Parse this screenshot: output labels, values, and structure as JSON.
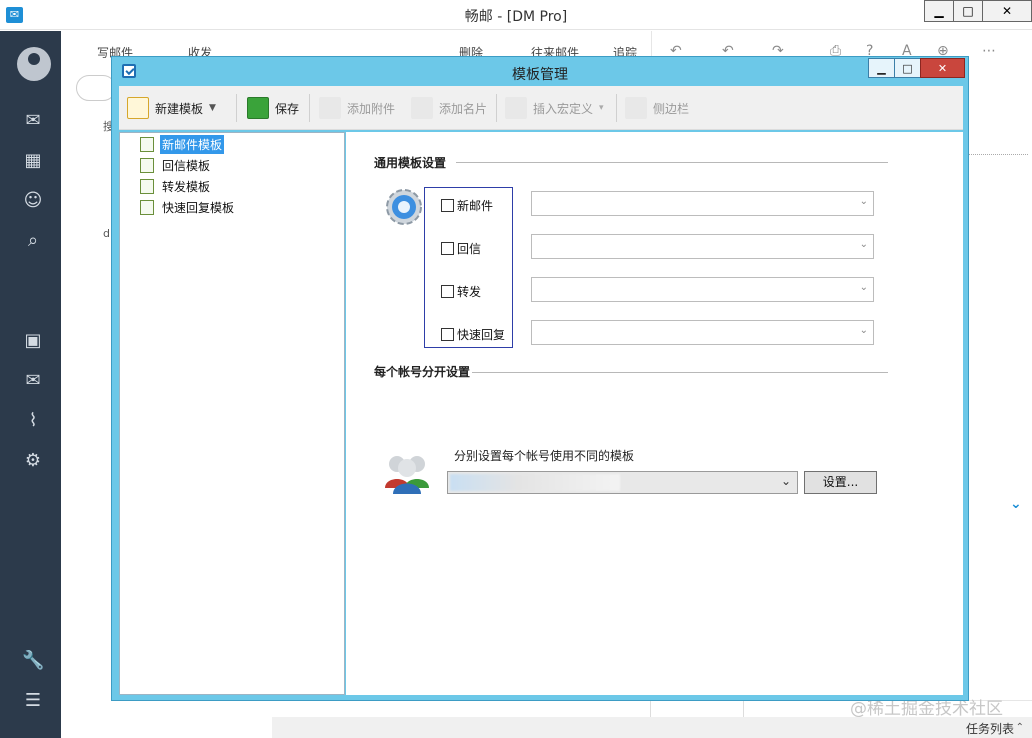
{
  "main_window": {
    "title": "畅邮 - [DM Pro]",
    "controls": {
      "minimize": "▁",
      "maximize": "□",
      "close": "✕"
    }
  },
  "background": {
    "toolbar": {
      "compose": "写邮件",
      "receive": "收发",
      "delete": "删除",
      "thread": "往来邮件",
      "track": "追踪"
    },
    "tree_labels": [
      "搜",
      "d"
    ],
    "status": {
      "task_list": "任务列表"
    },
    "watermark": "@稀土掘金技术社区"
  },
  "dialog": {
    "title": "模板管理",
    "controls": {
      "minimize": "▁",
      "maximize": "□",
      "close": "✕"
    },
    "toolbar": {
      "new_template": "新建模板",
      "save": "保存",
      "add_attachment": "添加附件",
      "add_card": "添加名片",
      "insert_macro": "插入宏定义",
      "sidebar": "侧边栏"
    },
    "tree": [
      {
        "label": "新邮件模板",
        "selected": true
      },
      {
        "label": "回信模板",
        "selected": false
      },
      {
        "label": "转发模板",
        "selected": false
      },
      {
        "label": "快速回复模板",
        "selected": false
      }
    ],
    "general": {
      "header": "通用模板设置",
      "rows": [
        {
          "label": "新邮件",
          "checked": false,
          "value": ""
        },
        {
          "label": "回信",
          "checked": false,
          "value": ""
        },
        {
          "label": "转发",
          "checked": false,
          "value": ""
        },
        {
          "label": "快速回复",
          "checked": false,
          "value": ""
        }
      ]
    },
    "per_account": {
      "header": "每个帐号分开设置",
      "description": "分别设置每个帐号使用不同的模板",
      "settings_button": "设置..."
    }
  },
  "colors": {
    "dialog_frame": "#6cc8e8",
    "selection": "#3398ea",
    "rail": "#2c3a4b",
    "close_button": "#c9463d"
  }
}
